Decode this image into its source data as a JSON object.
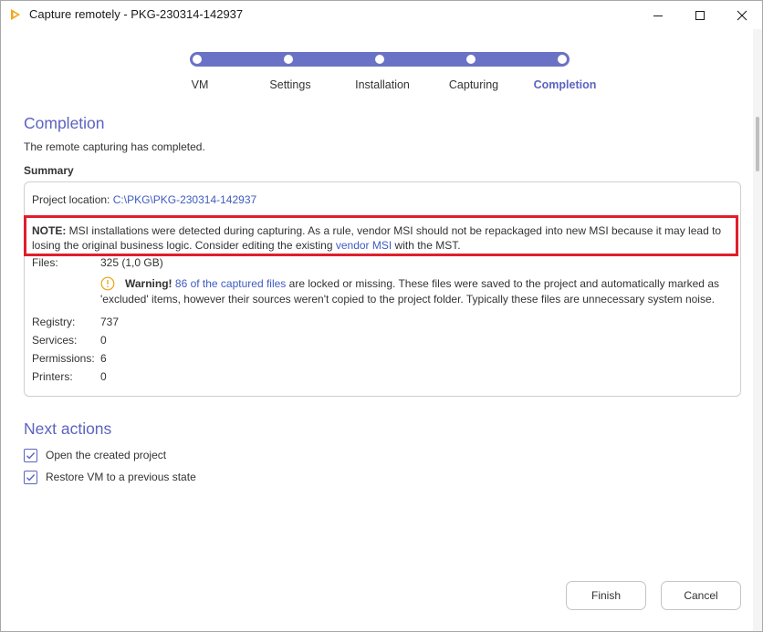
{
  "window": {
    "title": "Capture remotely - PKG-230314-142937"
  },
  "stepper": {
    "steps": [
      {
        "label": "VM"
      },
      {
        "label": "Settings"
      },
      {
        "label": "Installation"
      },
      {
        "label": "Capturing"
      },
      {
        "label": "Completion"
      }
    ],
    "active_step": "Completion"
  },
  "completion": {
    "heading": "Completion",
    "message": "The remote capturing has completed.",
    "summary_label": "Summary"
  },
  "summary": {
    "project_location_label": "Project location:",
    "project_location_value": "C:\\PKG\\PKG-230314-142937",
    "note": {
      "prefix": "NOTE:",
      "text_before_link": " MSI installations were detected during capturing. As a rule, vendor MSI should not be repackaged into new MSI because it may lead to losing the original business logic. Consider editing the existing ",
      "link": "vendor MSI",
      "text_after_link": " with the MST."
    },
    "files_label": "Files:",
    "files_value": "325 (1,0 GB)",
    "warning": {
      "prefix": "Warning!",
      "link": "86 of the captured files",
      "text": " are locked or missing. These files were saved to the project and automatically marked as 'excluded' items, however their sources weren't copied to the project folder. Typically these files are unnecessary system noise."
    },
    "stats": [
      {
        "label": "Registry:",
        "value": "737"
      },
      {
        "label": "Services:",
        "value": "0"
      },
      {
        "label": "Permissions:",
        "value": "6"
      },
      {
        "label": "Printers:",
        "value": "0"
      }
    ]
  },
  "next_actions": {
    "heading": "Next actions",
    "options": [
      {
        "label": "Open the created project",
        "checked": true
      },
      {
        "label": "Restore VM to a previous state",
        "checked": true
      }
    ]
  },
  "buttons": {
    "finish": "Finish",
    "cancel": "Cancel"
  },
  "colors": {
    "accent": "#5b63c0",
    "stepper_track": "#6a72c6",
    "link": "#3f5bc0",
    "highlight_border": "#e01e2c",
    "warning_icon": "#e8a317"
  }
}
